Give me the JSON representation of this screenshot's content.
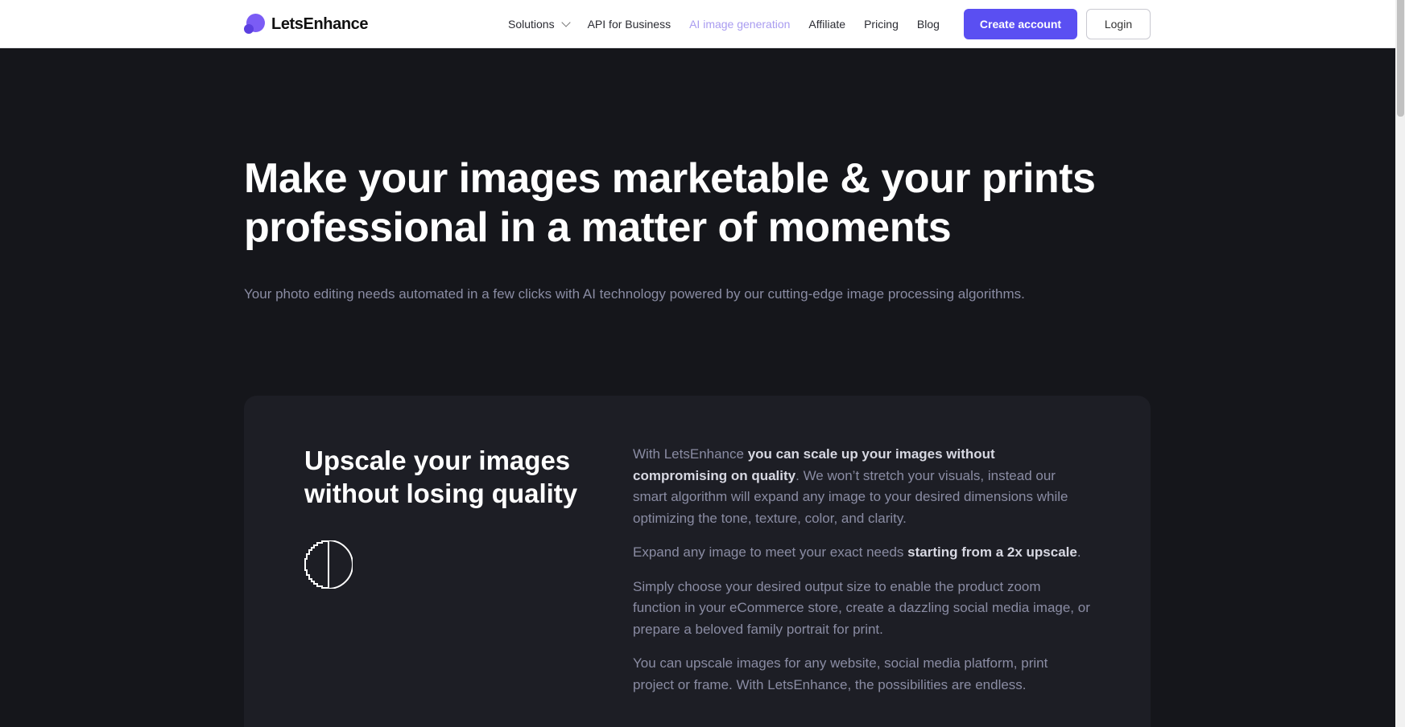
{
  "nav": {
    "logo_text": "LetsEnhance",
    "items": [
      {
        "label": "Solutions",
        "has_dropdown": true
      },
      {
        "label": "API for Business"
      },
      {
        "label": "AI image generation",
        "active": true
      },
      {
        "label": "Affiliate"
      },
      {
        "label": "Pricing"
      },
      {
        "label": "Blog"
      }
    ],
    "create_account_label": "Create account",
    "login_label": "Login"
  },
  "hero": {
    "title": "Make your images marketable & your prints professional in a matter of moments",
    "subtitle": "Your photo editing needs automated in a few clicks with AI technology powered by our cutting-edge image processing algorithms."
  },
  "feature": {
    "title": "Upscale your images without losing quality",
    "icon": "half-circle-icon",
    "p1": {
      "a": "With LetsEnhance ",
      "b": "you can scale up your images without compromising on quality",
      "c": ". We won’t stretch your visuals, instead our smart algorithm will expand any image to your desired dimensions while optimizing the tone, texture, color, and clarity."
    },
    "p2": {
      "a": "Expand any image to meet your exact needs ",
      "b": "starting from a 2x upscale",
      "c": "."
    },
    "p3": "Simply choose your desired output size to enable the product zoom function in your eCommerce store, create a dazzling social media image, or prepare a beloved family portrait for print.",
    "p4": "You can upscale images for any website, social media platform, print project or frame. With LetsEnhance, the possibilities are endless."
  },
  "colors": {
    "accent": "#5a4ff2",
    "active_link": "#a99cf0",
    "background": "#15161b",
    "card": "#1d1e25"
  }
}
